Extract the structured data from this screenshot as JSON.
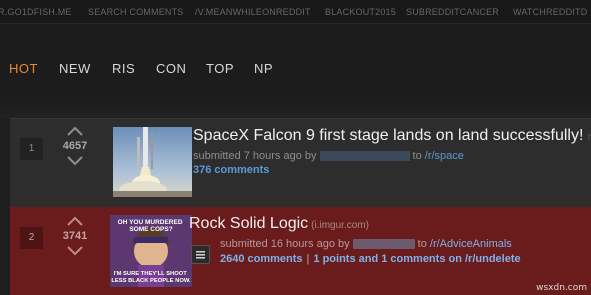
{
  "topbar": {
    "subreddits": [
      "R.GO1DFISH.ME",
      "SEARCH COMMENTS",
      "/V.MEANWHILEONREDDIT",
      "BLACKOUT2015",
      "SUBREDDITCANCER",
      "WATCHREDDITD"
    ]
  },
  "tabs": [
    {
      "label": "HOT",
      "active": true
    },
    {
      "label": "NEW",
      "active": false
    },
    {
      "label": "RIS",
      "active": false
    },
    {
      "label": "CON",
      "active": false
    },
    {
      "label": "TOP",
      "active": false
    },
    {
      "label": "NP",
      "active": false
    }
  ],
  "posts": [
    {
      "rank": "1",
      "score": "4657",
      "title": "SpaceX Falcon 9 first stage lands on land successfully!",
      "title_tail": "tw",
      "submitted": "submitted 7 hours ago by",
      "to": "to",
      "subreddit": "/r/space",
      "comments": "376 comments",
      "thumbnail_icon": "rocket-launch-thumbnail"
    },
    {
      "rank": "2",
      "score": "3741",
      "title": "Rock Solid Logic",
      "domain": "(i.imgur.com)",
      "submitted": "submitted 16 hours ago by",
      "to": "to",
      "subreddit": "/r/AdviceAnimals",
      "comments": "2640 comments",
      "extra_link": "1 points and 1 comments on /r/undelete",
      "separator": "|",
      "thumbnail_icon": "meme-thumbnail",
      "meme_top": "OH YOU MURDERED SOME COPS?",
      "meme_bottom": "I'M SURE THEY'LL SHOOT LESS BLACK PEOPLE NOW"
    }
  ],
  "watermark": "wsxdn.com",
  "colors": {
    "background": "#1e1e1e",
    "active_tab": "#e88832",
    "highlight_row": "#6a1b1b",
    "link": "#5d9ad6"
  }
}
